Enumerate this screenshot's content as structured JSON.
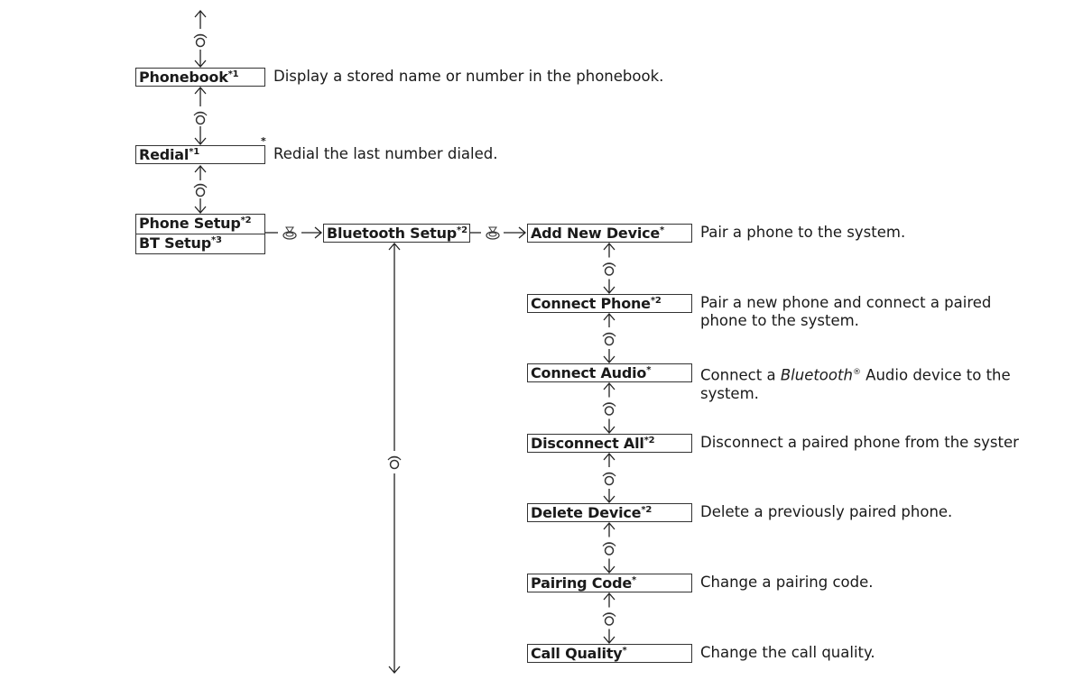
{
  "menu": {
    "level1": [
      {
        "label": "Phonebook",
        "note": "*1",
        "description": "Display a stored name or number in the phonebook."
      },
      {
        "label": "Redial",
        "note": "*1",
        "description": "Redial the last number dialed.",
        "corner_mark": "*"
      },
      {
        "label": "Phone Setup",
        "note": "*2",
        "alt_label": "BT Setup",
        "alt_note": "*3"
      }
    ],
    "level2": {
      "label": "Bluetooth Setup",
      "note": "*2"
    },
    "level3": [
      {
        "label": "Add New Device",
        "note": "*",
        "description": "Pair a phone to the system."
      },
      {
        "label": "Connect Phone",
        "note": "*2",
        "description_line1": "Pair a new phone and connect a paired",
        "description_line2": "phone to the system."
      },
      {
        "label": "Connect Audio",
        "note": "*",
        "description_pre": "Connect a ",
        "description_italic": "Bluetooth",
        "description_reg": "®",
        "description_post": " Audio device to the",
        "description_line2": "system."
      },
      {
        "label": "Disconnect All",
        "note": "*2",
        "description": "Disconnect a paired phone from the syster"
      },
      {
        "label": "Delete Device",
        "note": "*2",
        "description": "Delete a previously paired phone."
      },
      {
        "label": "Pairing Code",
        "note": "*",
        "description": "Change a pairing code."
      },
      {
        "label": "Call Quality",
        "note": "*",
        "description": "Change the call quality."
      }
    ]
  },
  "icons": {
    "rotate": "rotate-knob-icon",
    "press": "press-knob-icon",
    "arrow": "arrow-icon"
  }
}
